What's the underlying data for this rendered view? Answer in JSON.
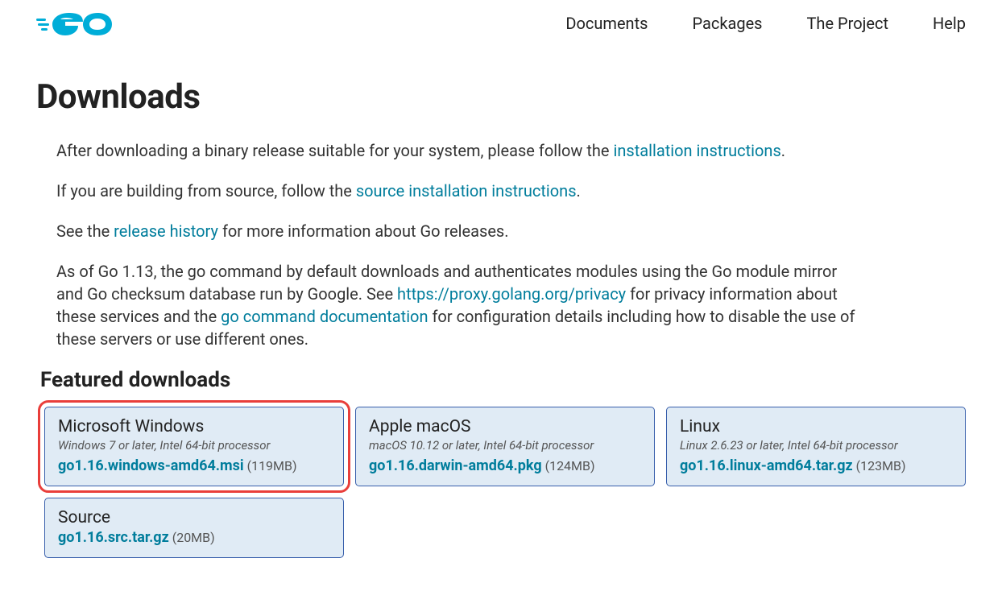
{
  "nav": {
    "documents": "Documents",
    "packages": "Packages",
    "project": "The Project",
    "help": "Help"
  },
  "page_title": "Downloads",
  "intro": {
    "p1_a": "After downloading a binary release suitable for your system, please follow the ",
    "p1_link": "installation instructions",
    "p1_b": ".",
    "p2_a": "If you are building from source, follow the ",
    "p2_link": "source installation instructions",
    "p2_b": ".",
    "p3_a": "See the ",
    "p3_link": "release history",
    "p3_b": " for more information about Go releases.",
    "p4_a": "As of Go 1.13, the go command by default downloads and authenticates modules using the Go module mirror and Go checksum database run by Google. See ",
    "p4_link1": "https://proxy.golang.org/privacy",
    "p4_b": " for privacy information about these services and the ",
    "p4_link2": "go command documentation",
    "p4_c": " for configuration details including how to disable the use of these servers or use different ones."
  },
  "featured_title": "Featured downloads",
  "downloads": {
    "windows": {
      "platform": "Microsoft Windows",
      "req": "Windows 7 or later, Intel 64-bit processor",
      "file": "go1.16.windows-amd64.msi",
      "size": "(119MB)"
    },
    "macos": {
      "platform": "Apple macOS",
      "req": "macOS 10.12 or later, Intel 64-bit processor",
      "file": "go1.16.darwin-amd64.pkg",
      "size": "(124MB)"
    },
    "linux": {
      "platform": "Linux",
      "req": "Linux 2.6.23 or later, Intel 64-bit processor",
      "file": "go1.16.linux-amd64.tar.gz",
      "size": "(123MB)"
    },
    "source": {
      "platform": "Source",
      "file": "go1.16.src.tar.gz",
      "size": "(20MB)"
    }
  }
}
